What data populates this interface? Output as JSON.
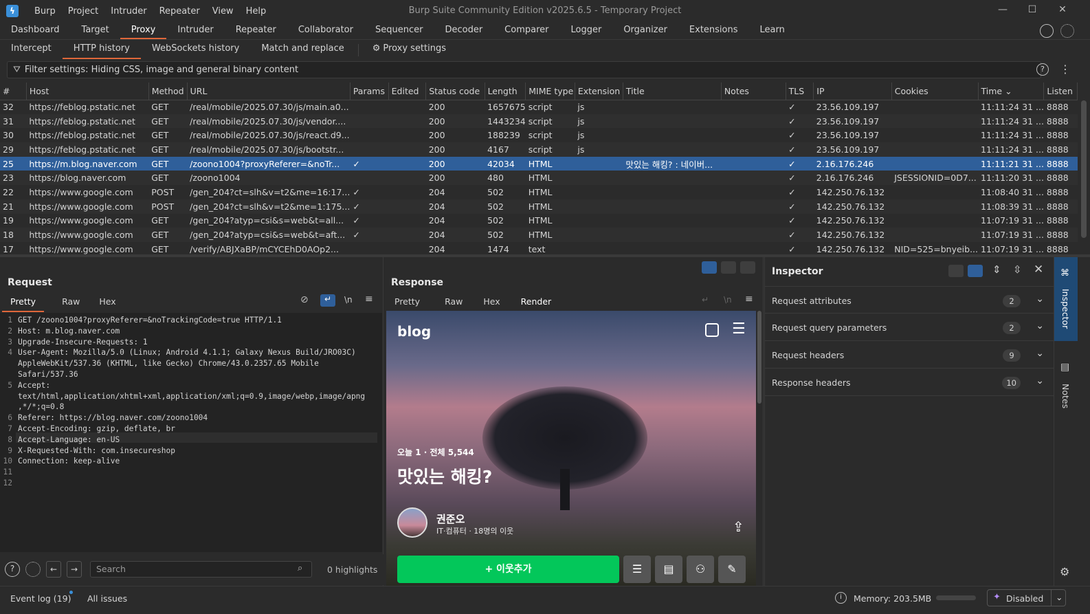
{
  "app": {
    "title": "Burp Suite Community Edition v2025.6.5 - Temporary Project"
  },
  "menu": [
    "Burp",
    "Project",
    "Intruder",
    "Repeater",
    "View",
    "Help"
  ],
  "main_tabs": [
    "Dashboard",
    "Target",
    "Proxy",
    "Intruder",
    "Repeater",
    "Collaborator",
    "Sequencer",
    "Decoder",
    "Comparer",
    "Logger",
    "Organizer",
    "Extensions",
    "Learn"
  ],
  "active_main_tab": "Proxy",
  "proxy_tabs": [
    "Intercept",
    "HTTP history",
    "WebSockets history",
    "Match and replace"
  ],
  "proxy_settings_label": "Proxy settings",
  "filter": {
    "text": "Filter settings: Hiding CSS, image and general binary content"
  },
  "table": {
    "columns": [
      "#",
      "Host",
      "Method",
      "URL",
      "Params",
      "Edited",
      "Status code",
      "Length",
      "MIME type",
      "Extension",
      "Title",
      "Notes",
      "TLS",
      "IP",
      "Cookies",
      "Time",
      "Listen"
    ],
    "rows": [
      {
        "id": "32",
        "host": "https://feblog.pstatic.net",
        "method": "GET",
        "url": "/real/mobile/2025.07.30/js/main.a0...",
        "params": "",
        "status": "200",
        "length": "1657675",
        "mime": "script",
        "ext": "js",
        "title": "",
        "tls": "✓",
        "ip": "23.56.109.197",
        "cookies": "",
        "time": "11:11:24 31 ...",
        "listen": "8888"
      },
      {
        "id": "31",
        "host": "https://feblog.pstatic.net",
        "method": "GET",
        "url": "/real/mobile/2025.07.30/js/vendor....",
        "params": "",
        "status": "200",
        "length": "1443234",
        "mime": "script",
        "ext": "js",
        "title": "",
        "tls": "✓",
        "ip": "23.56.109.197",
        "cookies": "",
        "time": "11:11:24 31 ...",
        "listen": "8888"
      },
      {
        "id": "30",
        "host": "https://feblog.pstatic.net",
        "method": "GET",
        "url": "/real/mobile/2025.07.30/js/react.d9...",
        "params": "",
        "status": "200",
        "length": "188239",
        "mime": "script",
        "ext": "js",
        "title": "",
        "tls": "✓",
        "ip": "23.56.109.197",
        "cookies": "",
        "time": "11:11:24 31 ...",
        "listen": "8888"
      },
      {
        "id": "29",
        "host": "https://feblog.pstatic.net",
        "method": "GET",
        "url": "/real/mobile/2025.07.30/js/bootstr...",
        "params": "",
        "status": "200",
        "length": "4167",
        "mime": "script",
        "ext": "js",
        "title": "",
        "tls": "✓",
        "ip": "23.56.109.197",
        "cookies": "",
        "time": "11:11:24 31 ...",
        "listen": "8888"
      },
      {
        "id": "25",
        "host": "https://m.blog.naver.com",
        "method": "GET",
        "url": "/zoono1004?proxyReferer=&noTr...",
        "params": "✓",
        "status": "200",
        "length": "42034",
        "mime": "HTML",
        "ext": "",
        "title": "맛있는 해킹? : 네이버...",
        "tls": "✓",
        "ip": "2.16.176.246",
        "cookies": "",
        "time": "11:11:21 31 ...",
        "listen": "8888"
      },
      {
        "id": "23",
        "host": "https://blog.naver.com",
        "method": "GET",
        "url": "/zoono1004",
        "params": "",
        "status": "200",
        "length": "480",
        "mime": "HTML",
        "ext": "",
        "title": "",
        "tls": "✓",
        "ip": "2.16.176.246",
        "cookies": "JSESSIONID=0D7...",
        "time": "11:11:20 31 ...",
        "listen": "8888"
      },
      {
        "id": "22",
        "host": "https://www.google.com",
        "method": "POST",
        "url": "/gen_204?ct=slh&v=t2&me=16:17...",
        "params": "✓",
        "status": "204",
        "length": "502",
        "mime": "HTML",
        "ext": "",
        "title": "",
        "tls": "✓",
        "ip": "142.250.76.132",
        "cookies": "",
        "time": "11:08:40 31 ...",
        "listen": "8888"
      },
      {
        "id": "21",
        "host": "https://www.google.com",
        "method": "POST",
        "url": "/gen_204?ct=slh&v=t2&me=1:175...",
        "params": "✓",
        "status": "204",
        "length": "502",
        "mime": "HTML",
        "ext": "",
        "title": "",
        "tls": "✓",
        "ip": "142.250.76.132",
        "cookies": "",
        "time": "11:08:39 31 ...",
        "listen": "8888"
      },
      {
        "id": "19",
        "host": "https://www.google.com",
        "method": "GET",
        "url": "/gen_204?atyp=csi&s=web&t=all...",
        "params": "✓",
        "status": "204",
        "length": "502",
        "mime": "HTML",
        "ext": "",
        "title": "",
        "tls": "✓",
        "ip": "142.250.76.132",
        "cookies": "",
        "time": "11:07:19 31 ...",
        "listen": "8888"
      },
      {
        "id": "18",
        "host": "https://www.google.com",
        "method": "GET",
        "url": "/gen_204?atyp=csi&s=web&t=aft...",
        "params": "✓",
        "status": "204",
        "length": "502",
        "mime": "HTML",
        "ext": "",
        "title": "",
        "tls": "✓",
        "ip": "142.250.76.132",
        "cookies": "",
        "time": "11:07:19 31 ...",
        "listen": "8888"
      },
      {
        "id": "17",
        "host": "https://www.google.com",
        "method": "GET",
        "url": "/verify/ABJXaBP/mCYCEhD0AOp2...",
        "params": "",
        "status": "204",
        "length": "1474",
        "mime": "text",
        "ext": "",
        "title": "",
        "tls": "✓",
        "ip": "142.250.76.132",
        "cookies": "NID=525=bnyeib...",
        "time": "11:07:19 31 ...",
        "listen": "8888"
      }
    ]
  },
  "request": {
    "title": "Request",
    "tabs": [
      "Pretty",
      "Raw",
      "Hex"
    ],
    "lines": [
      "GET /zoono1004?proxyReferer=&noTrackingCode=true HTTP/1.1",
      "Host: m.blog.naver.com",
      "Upgrade-Insecure-Requests: 1",
      "User-Agent: Mozilla/5.0 (Linux; Android 4.1.1; Galaxy Nexus Build/JRO03C)",
      "AppleWebKit/537.36 (KHTML, like Gecko) Chrome/43.0.2357.65 Mobile",
      "Safari/537.36",
      "Accept:",
      "text/html,application/xhtml+xml,application/xml;q=0.9,image/webp,image/apng",
      ",*/*;q=0.8",
      "Referer: https://blog.naver.com/zoono1004",
      "Accept-Encoding: gzip, deflate, br",
      "Accept-Language: en-US",
      "X-Requested-With: com.insecureshop",
      "Connection: keep-alive",
      "",
      ""
    ],
    "line_numbers": [
      "1",
      "2",
      "3",
      "4",
      "",
      "",
      "5",
      "",
      "",
      "6",
      "7",
      "8",
      "9",
      "10",
      "11",
      "12"
    ],
    "search_placeholder": "Search",
    "highlights": "0 highlights"
  },
  "response": {
    "title": "Response",
    "tabs": [
      "Pretty",
      "Raw",
      "Hex",
      "Render"
    ],
    "render": {
      "logo": "blog",
      "stats": "오늘 1 · 전체 5,544",
      "headline": "맛있는 해킹?",
      "author": "권준오",
      "author_sub": "IT·컴퓨터 · 18명의 이웃",
      "add_button": "+ 이웃추가"
    }
  },
  "inspector": {
    "title": "Inspector",
    "rows": [
      {
        "label": "Request attributes",
        "count": "2"
      },
      {
        "label": "Request query parameters",
        "count": "2"
      },
      {
        "label": "Request headers",
        "count": "9"
      },
      {
        "label": "Response headers",
        "count": "10"
      }
    ]
  },
  "sidebar": {
    "inspector": "Inspector",
    "notes": "Notes"
  },
  "status": {
    "event_log": "Event log (19)",
    "all_issues": "All issues",
    "memory": "Memory: 203.5MB",
    "disabled": "Disabled"
  },
  "colors": {
    "accent": "#e0673a",
    "selection": "#2f5f9a",
    "naver_green": "#03c75a"
  }
}
